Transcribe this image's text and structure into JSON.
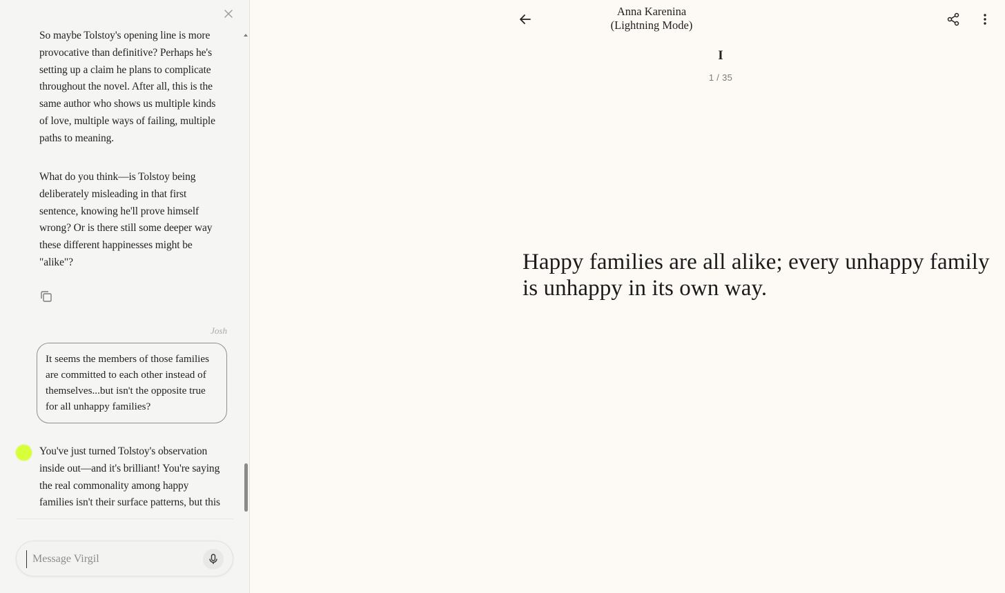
{
  "chat": {
    "messages": [
      {
        "role": "assistant",
        "paragraphs": [
          "So maybe Tolstoy's opening line is more provocative than definitive? Perhaps he's setting up a claim he plans to complicate throughout the novel. After all, this is the same author who shows us multiple kinds of love, multiple ways of failing, multiple paths to meaning.",
          "What do you think—is Tolstoy being deliberately misleading in that first sentence, knowing he'll prove himself wrong? Or is there still some deeper way these different happinesses might be \"alike\"?"
        ]
      },
      {
        "role": "user",
        "sender": "Josh",
        "text": "It seems the members of those families are committed to each other instead of themselves...but isn't the opposite true for all unhappy families?"
      },
      {
        "role": "assistant",
        "text": "You've just turned Tolstoy's observation inside out—and it's brilliant! You're saying the real commonality among happy families isn't their surface patterns, but this"
      }
    ],
    "composer": {
      "placeholder": "Message Virgil"
    },
    "colors": {
      "avatar": "#d7ff3a",
      "panel_bg": "#f5f5f4"
    }
  },
  "reader": {
    "title_line1": "Anna Karenina",
    "title_line2": "(Lightning Mode)",
    "chapter": "I",
    "page_indicator": "1 / 35",
    "passage": "Happy families are all alike; every unhappy family is unhappy in its own way.",
    "colors": {
      "bg": "#fdfaf5"
    }
  },
  "icons": {
    "close": "close-icon",
    "copy": "copy-icon",
    "mic": "microphone-icon",
    "back": "arrow-left-icon",
    "share": "share-icon",
    "more": "more-vertical-icon"
  }
}
